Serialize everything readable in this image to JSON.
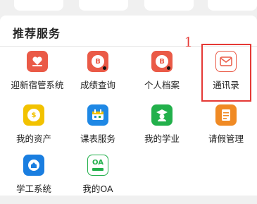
{
  "section": {
    "title": "推荐服务"
  },
  "annotation": {
    "number": "1",
    "color": "#e53935"
  },
  "services": [
    {
      "label": "迎新宿管系统",
      "icon": "heart-hands-icon",
      "color": "#ea5a47"
    },
    {
      "label": "成绩查询",
      "icon": "grade-lookup-icon",
      "color": "#ea5a47"
    },
    {
      "label": "个人档案",
      "icon": "profile-archive-icon",
      "color": "#ea5a47"
    },
    {
      "label": "通讯录",
      "icon": "address-book-icon",
      "color": "#ea5a47"
    },
    {
      "label": "我的资产",
      "icon": "coins-icon",
      "color": "#f2c200"
    },
    {
      "label": "课表服务",
      "icon": "calendar-icon",
      "color": "#1e88e5"
    },
    {
      "label": "我的学业",
      "icon": "graduate-icon",
      "color": "#22b04b"
    },
    {
      "label": "请假管理",
      "icon": "leave-document-icon",
      "color": "#f08a24"
    },
    {
      "label": "学工系统",
      "icon": "student-work-icon",
      "color": "#1a7ee0"
    },
    {
      "label": "我的OA",
      "icon": "oa-icon",
      "color": "#22b04b",
      "icon_text": "OA"
    }
  ]
}
